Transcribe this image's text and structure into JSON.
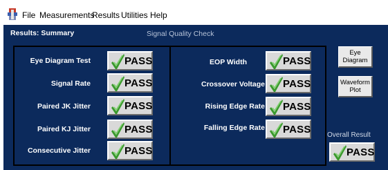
{
  "menu": {
    "file": "File",
    "measurements": "Measurements",
    "results": "Results",
    "utilities": "Utilities",
    "help": "Help"
  },
  "panel": {
    "title": "Results: Summary",
    "subtitle": "Signal Quality Check"
  },
  "left_tests": [
    {
      "label": "Eye Diagram Test",
      "result": "PASS"
    },
    {
      "label": "Signal Rate",
      "result": "PASS"
    },
    {
      "label": "Paired JK Jitter",
      "result": "PASS"
    },
    {
      "label": "Paired KJ Jitter",
      "result": "PASS"
    },
    {
      "label": "Consecutive Jitter",
      "result": "PASS"
    }
  ],
  "right_tests": [
    {
      "label": "EOP Width",
      "result": "PASS"
    },
    {
      "label": "Crossover Voltage",
      "result": "PASS"
    },
    {
      "label": "Rising Edge Rate",
      "result": "PASS"
    },
    {
      "label": "Falling Edge Rate",
      "result": "PASS"
    }
  ],
  "buttons": {
    "eye_diagram_line1": "Eye",
    "eye_diagram_line2": "Diagram",
    "waveform_plot_line1": "Waveform",
    "waveform_plot_line2": "Plot"
  },
  "overall": {
    "label": "Overall Result",
    "result": "PASS"
  },
  "colors": {
    "panel_bg": "#0c2a5c",
    "check_green": "#3a9a2c"
  },
  "icons": {
    "app": "tektronix-app-icon",
    "check": "checkmark-icon"
  }
}
